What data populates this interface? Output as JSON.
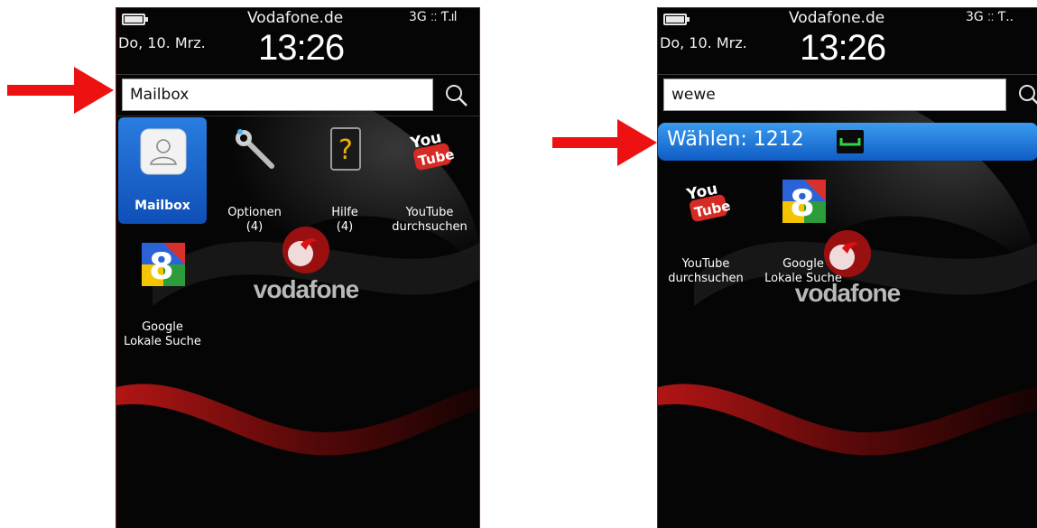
{
  "left_screen": {
    "status": {
      "date": "Do, 10. Mrz.",
      "carrier": "Vodafone.de",
      "time": "13:26",
      "network": "3G ☷ Ʈ..▐▐"
    },
    "search": {
      "value": "Mailbox"
    },
    "apps": [
      {
        "label": "Mailbox",
        "icon": "contact-icon",
        "selected": true
      },
      {
        "label": "Optionen\n(4)",
        "icon": "wrench-icon"
      },
      {
        "label": "Hilfe\n(4)",
        "icon": "help-icon"
      },
      {
        "label": "YouTube\ndurchsuchen",
        "icon": "youtube-icon"
      },
      {
        "label": "Google\nLokale Suche",
        "icon": "google-local-icon"
      }
    ],
    "logo_text": "vodafone"
  },
  "right_screen": {
    "status": {
      "date": "Do, 10. Mrz.",
      "carrier": "Vodafone.de",
      "time": "13:26",
      "network": "3G ☷ Ʈ.."
    },
    "search": {
      "value": "wewe"
    },
    "dial_suggestion": "Wählen: 1212",
    "apps": [
      {
        "label": "YouTube\ndurchsuchen",
        "icon": "youtube-icon"
      },
      {
        "label": "Google\nLokale Suche",
        "icon": "google-local-icon"
      }
    ],
    "logo_text": "vodafone"
  },
  "colors": {
    "arrow": "#ee1111",
    "selection": "#1a62c8",
    "frame": "#7a1c1c"
  }
}
